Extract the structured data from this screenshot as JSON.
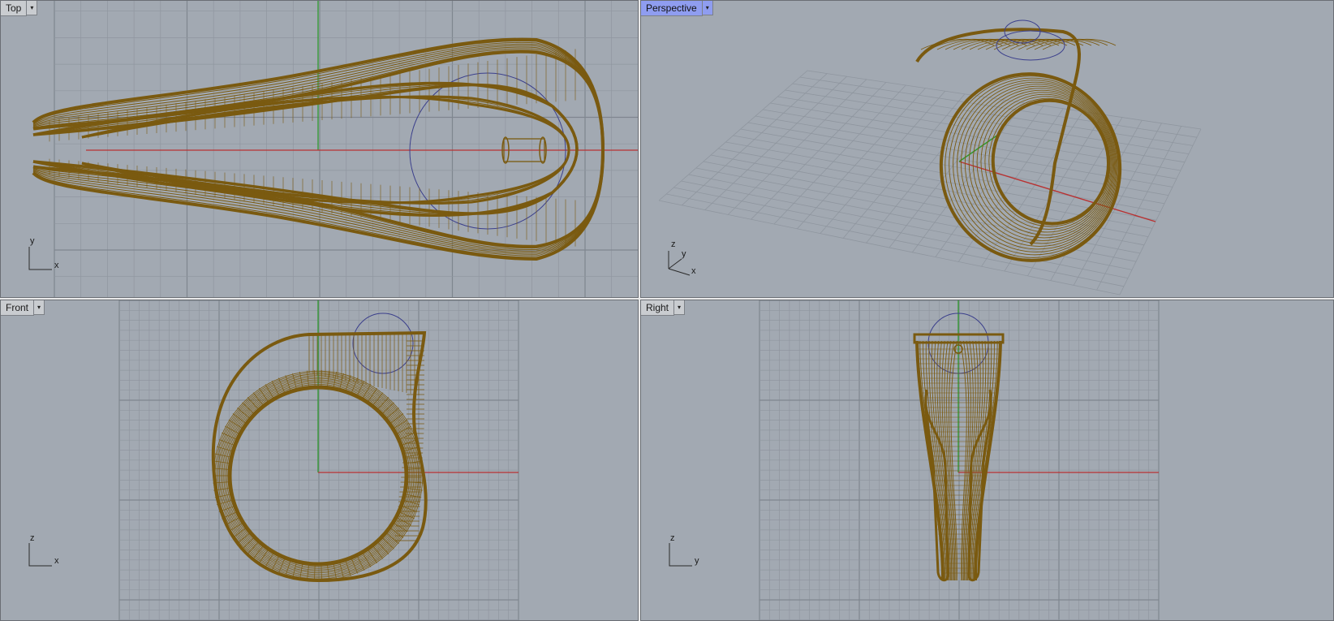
{
  "viewports": [
    {
      "id": "top",
      "title": "Top",
      "active": false,
      "axis1": "x",
      "axis2": "y"
    },
    {
      "id": "perspective",
      "title": "Perspective",
      "active": true,
      "axis1": "x",
      "axis2": "y",
      "axis3": "z"
    },
    {
      "id": "front",
      "title": "Front",
      "active": false,
      "axis1": "x",
      "axis2": "z"
    },
    {
      "id": "right",
      "title": "Right",
      "active": false,
      "axis1": "y",
      "axis2": "z"
    }
  ],
  "colors": {
    "background": "#a2a9b2",
    "grid": "#8f969f",
    "grid_major": "#7f868f",
    "x_axis": "#b83232",
    "y_axis": "#2f9a2f",
    "wire": "#7a5a10",
    "wire_light": "#9a7420",
    "cplane_circle": "#3b3f8c",
    "active_tab": "#8f9df0"
  },
  "icons": {
    "viewport_menu": "dropdown-arrow-icon"
  }
}
